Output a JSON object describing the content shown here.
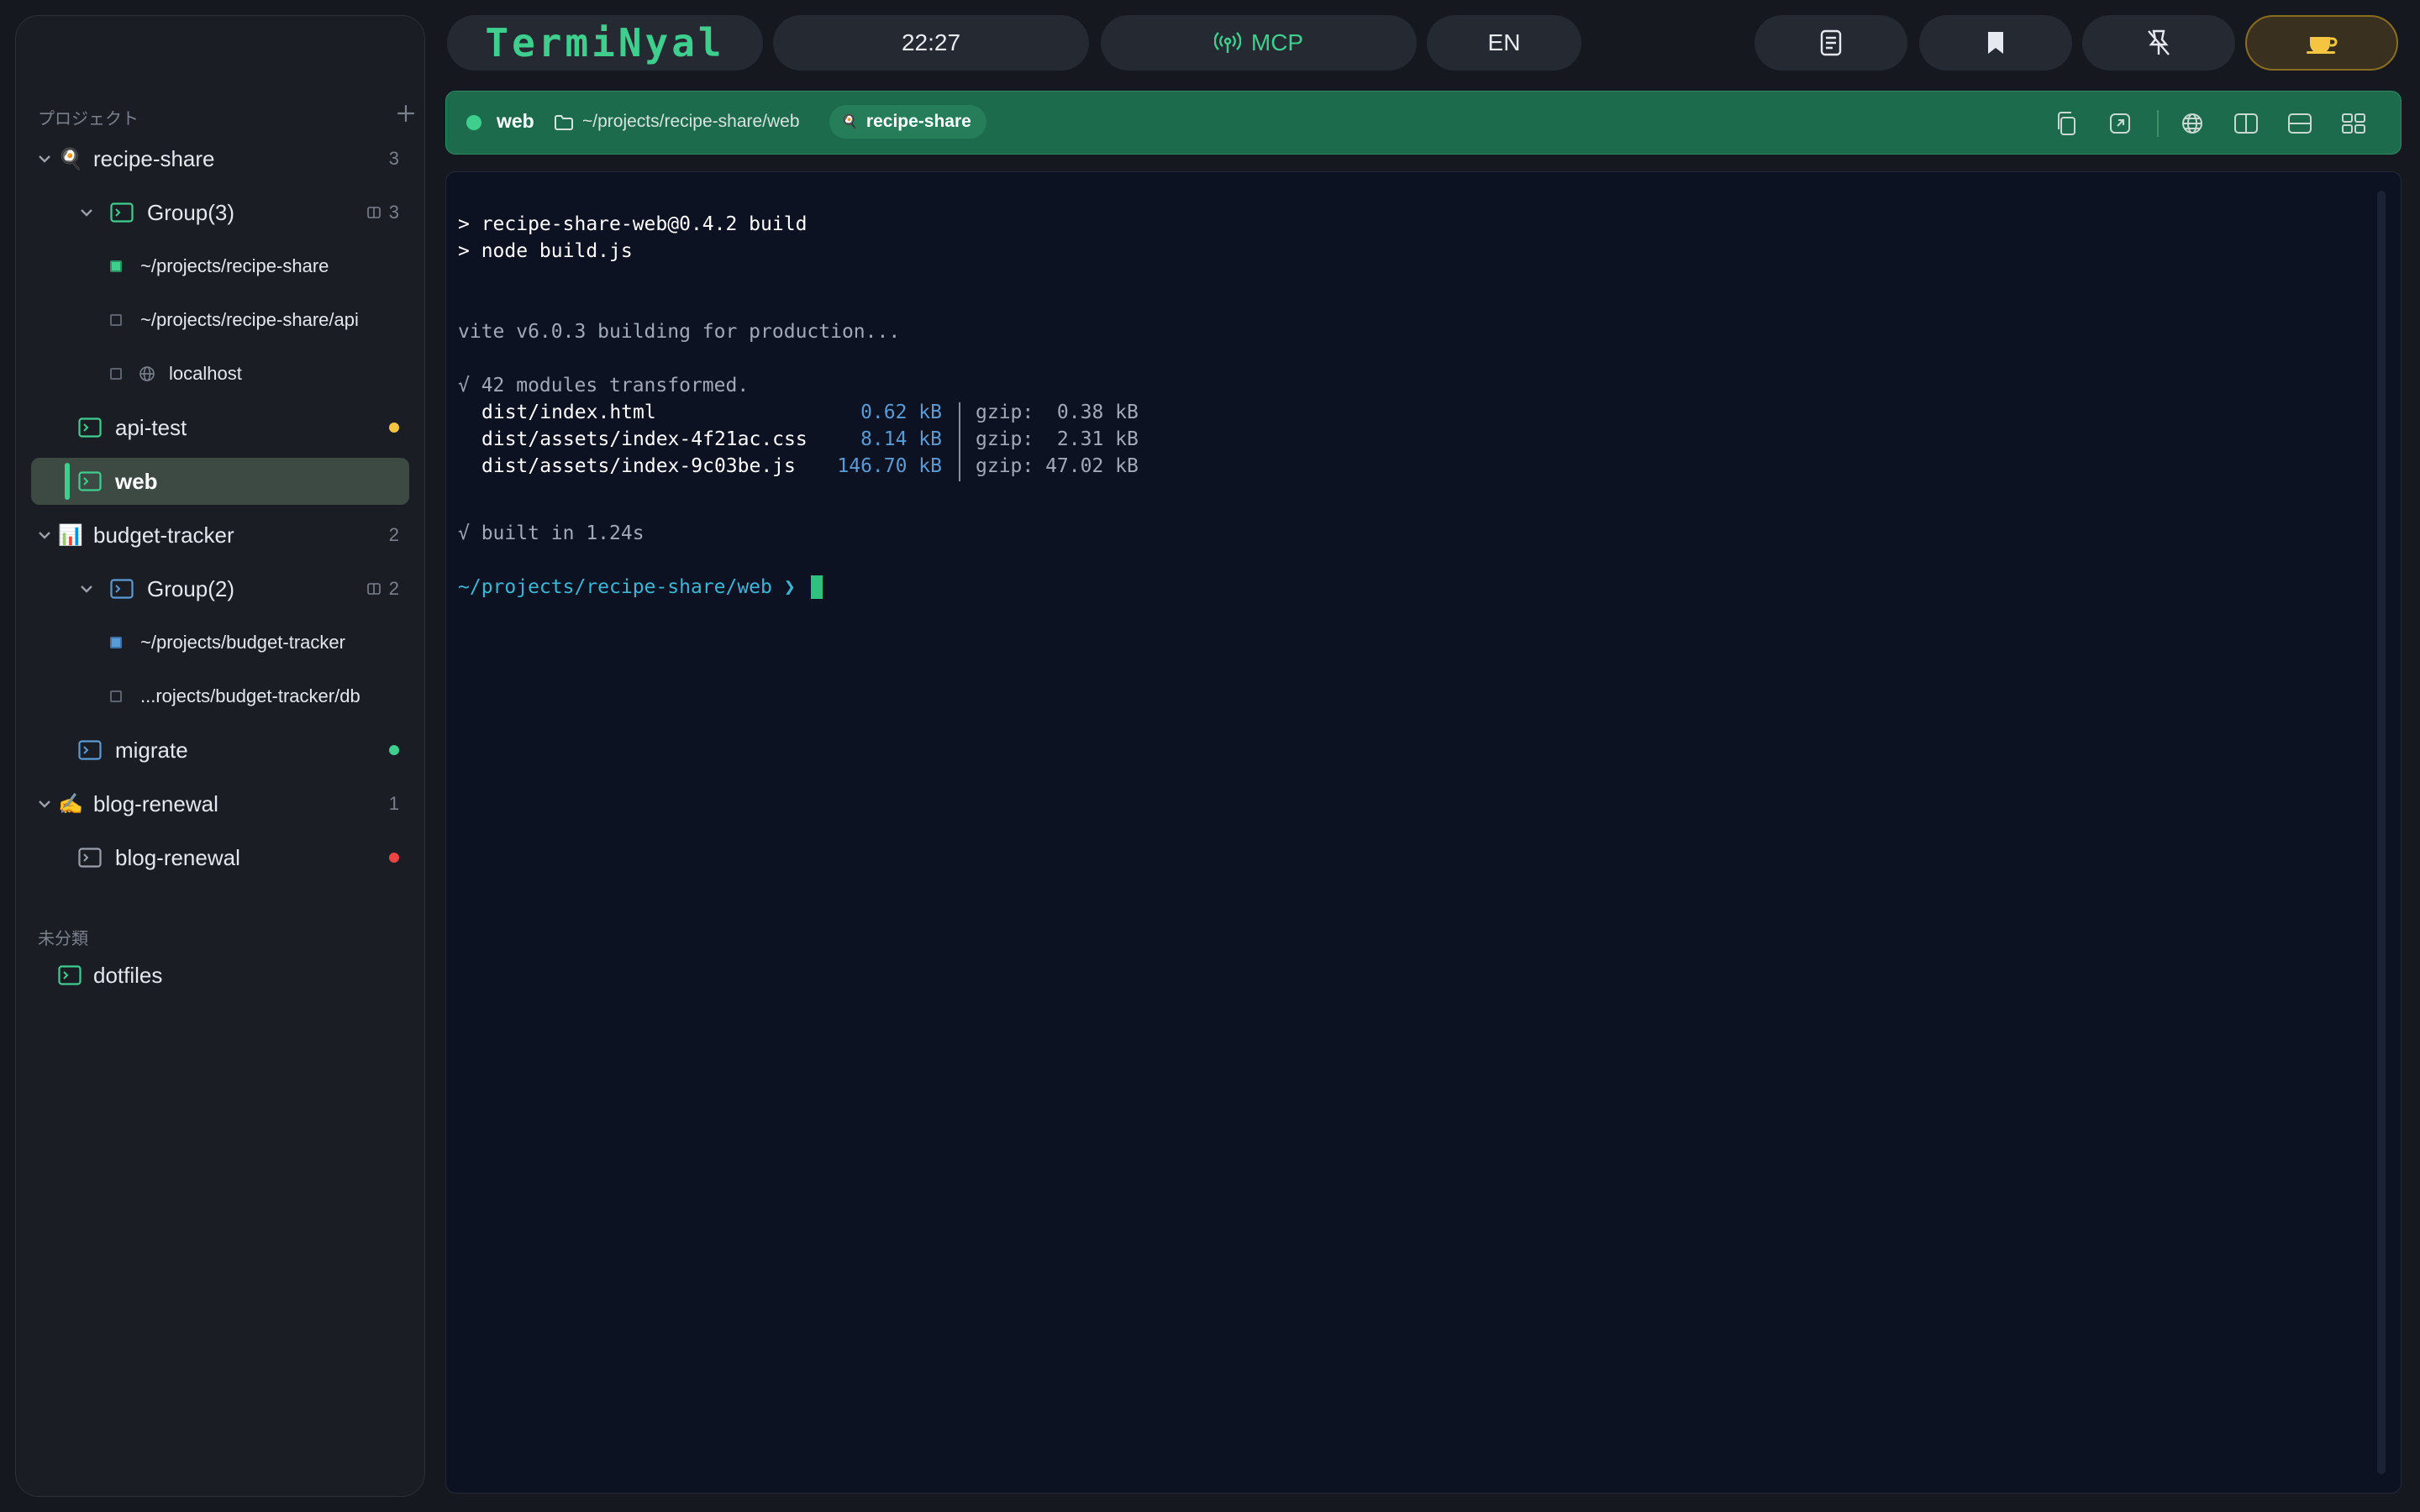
{
  "toolbar": {
    "app_name": "TermiNyal",
    "clock": "22:27",
    "mcp_label": "MCP",
    "lang_label": "EN"
  },
  "sidebar": {
    "projects_heading": "プロジェクト",
    "uncategorized_heading": "未分類",
    "projects": [
      {
        "emoji": "🍳",
        "name": "recipe-share",
        "count": "3",
        "group": {
          "name": "Group(3)",
          "count": "3",
          "panes": [
            "~/projects/recipe-share",
            "~/projects/recipe-share/api",
            "localhost"
          ]
        },
        "sessions": [
          {
            "name": "api-test",
            "status_color": "#f5c542"
          },
          {
            "name": "web"
          }
        ]
      },
      {
        "emoji": "📊",
        "name": "budget-tracker",
        "count": "2",
        "group": {
          "name": "Group(2)",
          "count": "2",
          "panes": [
            "~/projects/budget-tracker",
            "...rojects/budget-tracker/db"
          ]
        },
        "sessions": [
          {
            "name": "migrate",
            "status_color": "#3ecf8e"
          }
        ]
      },
      {
        "emoji": "✍️",
        "name": "blog-renewal",
        "count": "1",
        "sessions": [
          {
            "name": "blog-renewal",
            "status_color": "#ef4444"
          }
        ]
      }
    ],
    "uncategorized": [
      {
        "name": "dotfiles"
      }
    ]
  },
  "tabbar": {
    "session_name": "web",
    "path": "~/projects/recipe-share/web",
    "project_badge": "recipe-share",
    "project_badge_emoji": "🍳",
    "accent_color": "#1d6b4d"
  },
  "terminal": {
    "cmd_line1": "> recipe-share-web@0.4.2 build",
    "cmd_line2": "> node build.js",
    "vite_line": "vite v6.0.3 building for production...",
    "transformed_line": "√ 42 modules transformed.",
    "files": [
      {
        "name": "dist/index.html",
        "size": "0.62 kB",
        "gzip": "gzip:  0.38 kB"
      },
      {
        "name": "dist/assets/index-4f21ac.css",
        "size": "8.14 kB",
        "gzip": "gzip:  2.31 kB"
      },
      {
        "name": "dist/assets/index-9c03be.js",
        "size": "146.70 kB",
        "gzip": "gzip: 47.02 kB"
      }
    ],
    "built_line": "√ built in 1.24s",
    "prompt_path": "~/projects/recipe-share/web",
    "prompt_symbol": "❯"
  },
  "colors": {
    "green": "#3ecf8e",
    "blue": "#5b9bd5",
    "yellow": "#f5c542",
    "red": "#ef4444",
    "prompt": "#38b8d6"
  }
}
